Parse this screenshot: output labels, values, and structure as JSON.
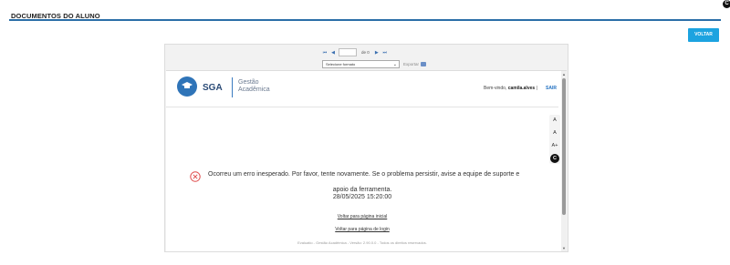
{
  "page": {
    "title": "DOCUMENTOS DO ALUNO",
    "corner_badge": "C",
    "back_button": "VOLTAR"
  },
  "viewer": {
    "toolbar": {
      "first_icon": "⏮",
      "prev_icon": "◀",
      "page_value": "",
      "of_label": "de 0",
      "next_icon": "▶",
      "last_icon": "⏭",
      "format_placeholder": "Selecione formato",
      "export_label": "Exportar"
    },
    "report": {
      "app_short": "SGA",
      "app_name_line1": "Gestão",
      "app_name_line2": "Acadêmica",
      "welcome_prefix": "Bem-vindo, ",
      "username": "camila.alves",
      "separator": " |",
      "logout": "SAIR",
      "font_controls": [
        "A",
        "A",
        "A+"
      ],
      "contrast_label": "C",
      "error_line1": "Ocorreu um erro inesperado. Por favor, tente novamente. Se o problema persistir, avise a equipe de suporte e",
      "error_line2": "apoio da ferramenta.",
      "error_datetime": "28/05/2025 15:20:00",
      "link_home": "Voltar para página inicial",
      "link_login": "Voltar para página de login",
      "footer": "Evaluatio - Gestão Acadêmica - Versão: 2.90.0.0 - Todos os direitos reservados."
    }
  },
  "colors": {
    "accent_blue": "#1ca3e0",
    "title_rule": "#2b6ea8",
    "error_red": "#e05050"
  }
}
